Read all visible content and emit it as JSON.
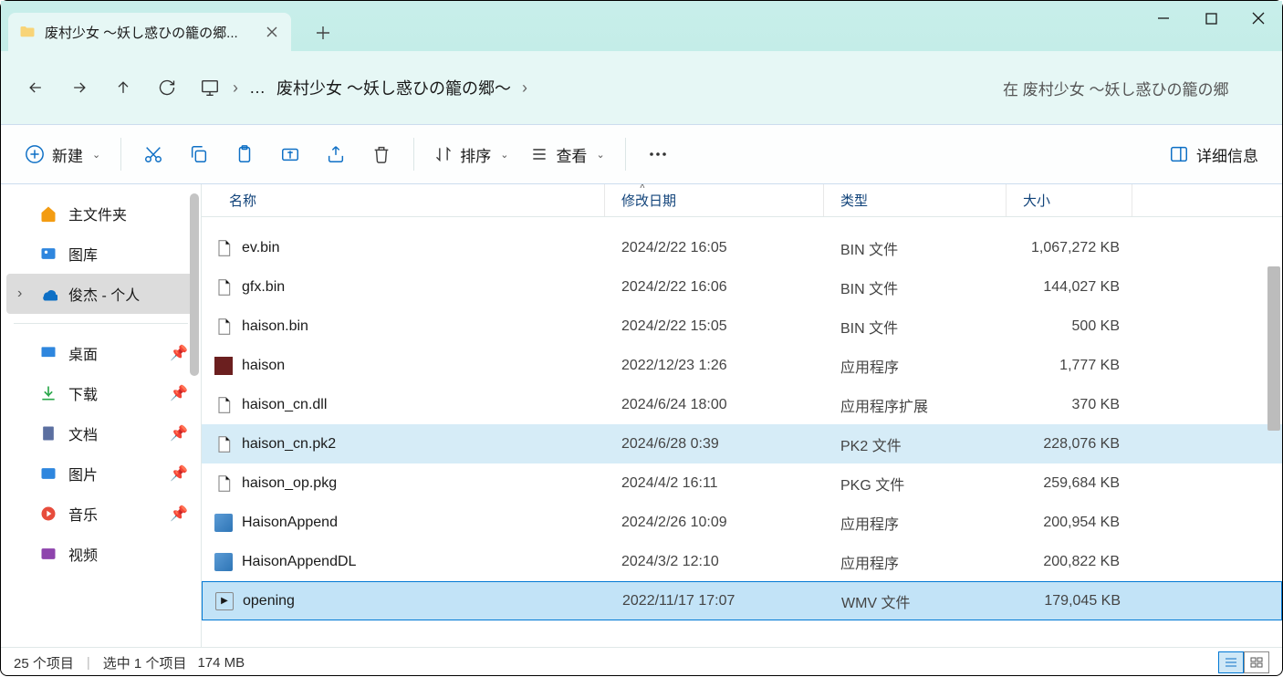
{
  "window": {
    "tab_title": "废村少女 ～妖し惑ひの籠の郷..."
  },
  "address": {
    "current_folder": "废村少女 ～妖し惑ひの籠の郷～",
    "search_placeholder": "在 废村少女 ～妖し惑ひの籠の郷"
  },
  "toolbar": {
    "new_label": "新建",
    "sort_label": "排序",
    "view_label": "查看",
    "details_label": "详细信息"
  },
  "sidebar": {
    "home": "主文件夹",
    "gallery": "图库",
    "user": "俊杰 - 个人",
    "desktop": "桌面",
    "downloads": "下载",
    "documents": "文档",
    "pictures": "图片",
    "music": "音乐",
    "videos": "视频"
  },
  "columns": {
    "name": "名称",
    "date": "修改日期",
    "type": "类型",
    "size": "大小"
  },
  "files": [
    {
      "name": "ev.bin",
      "date": "2024/2/22 16:05",
      "type": "BIN 文件",
      "size": "1,067,272 KB",
      "icon": "file"
    },
    {
      "name": "gfx.bin",
      "date": "2024/2/22 16:06",
      "type": "BIN 文件",
      "size": "144,027 KB",
      "icon": "file"
    },
    {
      "name": "haison.bin",
      "date": "2024/2/22 15:05",
      "type": "BIN 文件",
      "size": "500 KB",
      "icon": "file"
    },
    {
      "name": "haison",
      "date": "2022/12/23 1:26",
      "type": "应用程序",
      "size": "1,777 KB",
      "icon": "haison"
    },
    {
      "name": "haison_cn.dll",
      "date": "2024/6/24 18:00",
      "type": "应用程序扩展",
      "size": "370 KB",
      "icon": "file"
    },
    {
      "name": "haison_cn.pk2",
      "date": "2024/6/28 0:39",
      "type": "PK2 文件",
      "size": "228,076 KB",
      "icon": "file",
      "highlight": true
    },
    {
      "name": "haison_op.pkg",
      "date": "2024/4/2 16:11",
      "type": "PKG 文件",
      "size": "259,684 KB",
      "icon": "file"
    },
    {
      "name": "HaisonAppend",
      "date": "2024/2/26 10:09",
      "type": "应用程序",
      "size": "200,954 KB",
      "icon": "exe"
    },
    {
      "name": "HaisonAppendDL",
      "date": "2024/3/2 12:10",
      "type": "应用程序",
      "size": "200,822 KB",
      "icon": "exe"
    },
    {
      "name": "opening",
      "date": "2022/11/17 17:07",
      "type": "WMV 文件",
      "size": "179,045 KB",
      "icon": "wmv",
      "selected": true
    }
  ],
  "status": {
    "count": "25 个项目",
    "selected": "选中 1 个项目",
    "size": "174 MB"
  }
}
